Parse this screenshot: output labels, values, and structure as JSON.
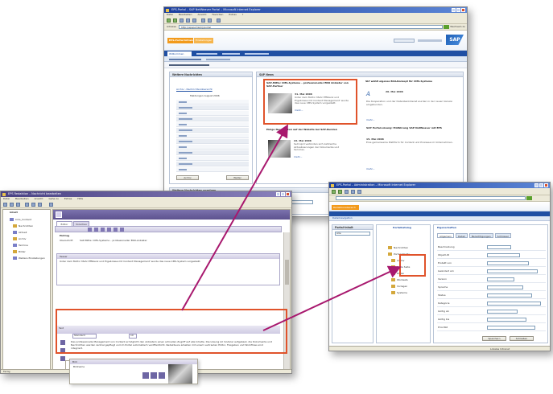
{
  "browser_window": {
    "title": "EPS-Portal – SAP NetWeaver Portal – Microsoft Internet Explorer",
    "menu": [
      "Datei",
      "Bearbeiten",
      "Ansicht",
      "Favoriten",
      "Extras",
      "?"
    ],
    "address_label": "Adresse",
    "address": "http://epsportal/irj/portal",
    "go_label": "Wechseln zu",
    "header_tabs": [
      "EPS-Portal Intranet",
      "Einstellungen"
    ],
    "sap_logo": "SAP",
    "welcome": "Willkommen",
    "news_title": "SAP News",
    "left_portlet_title": "Weitere Nachrichten",
    "left_portlet_link": "Archiv › Nachrichtenübersicht",
    "left_portlet_subtitle": "Meldungen August 2006",
    "left_buttons": [
      "Archiv",
      "Weiter"
    ],
    "news_items": [
      {
        "headline": "SAP-Mitte: CMS-Systeme – professioneller ERD Anbieter von SAP-Partner",
        "date": "31. Mai 2006",
        "body": "Unter dem Motto 'Mehr Effizienz und Ergebnisse mit Content Management' wurde das neue CMS-System vorgestellt.",
        "more": "mehr..."
      },
      {
        "headline": "Einige Neuigkeiten auf der Website bei SAP-Kunden",
        "date": "22. Mai 2006",
        "body": "Seit April verbinden sich zahlreiche Aktualisierungen der Dokumente und Services.",
        "more": "mehr..."
      },
      {
        "headline": "SLT wählt eigenes Bild-Konzept für CMS-Systeme",
        "date": "20. Mai 2006",
        "body": "Die Kooperation und der Datenbankdienst wurden in der neuen Version eingebunden.",
        "more": "mehr..."
      },
      {
        "headline": "SAP Portal-Lösung: Einführung SAP NetWeaver mit EPS",
        "date": "15. Mai 2006",
        "body": "Eine gemeinsame Plattform für Content und Prozesse im Unternehmen.",
        "more": "mehr..."
      }
    ],
    "bottom_section_title": "Weitere Nachrichten anzeigen",
    "bottom_labels": [
      "Inhalt",
      "Kategorie",
      "Sortierung"
    ]
  },
  "editor_window": {
    "title": "EPS Redaktion – Nachricht bearbeiten",
    "menu": [
      "Datei",
      "Bearbeiten",
      "Ansicht",
      "Gehe zu",
      "Extras",
      "Hilfe"
    ],
    "tree_root": "Inhalt",
    "tree_items": [
      "Cms_Content",
      "Nachrichten",
      "Aktuell",
      "Archiv",
      "Termine",
      "Bilder",
      "Weitere Einstellungen"
    ],
    "tabs": [
      "Editor",
      "Vorschau"
    ],
    "section_1": "Eintrag",
    "title_label": "Überschrift",
    "title_value": "SAP-Mitte: CMS-Systeme – professioneller ERD-Anbieter",
    "teaser_label": "Teaser",
    "teaser_value": "Unter dem Motto 'Mehr Effizienz und Ergebnisse mit Content Management' wurde das neue CMS-System vorgestellt.",
    "text_label": "Text",
    "format_select": "Standard",
    "format_size": "10",
    "body_text": "Das professionelle Management von Content ermöglicht den Anbietern einen schnellen Zugriff auf alle Inhalte. Die Lösung ist modular aufgebaut, die Dokumente und Nachrichten werden zentral gepflegt und im Portal automatisch veröffentlicht. Redakteure arbeiten mit einem vertrauten Editor, Freigaben und Workflows sind integriert.",
    "image_label": "Bild",
    "image_value": "Bildname",
    "status": "Fertig"
  },
  "admin_window": {
    "title": "EPS-Portal – Administration – Microsoft Internet Explorer",
    "header_tab": "Redaktionsbereich",
    "crumb": "Detailnavigation",
    "left_title": "Portal-Inhalt",
    "left_select": "Alle",
    "tree_title": "Portalkatalog",
    "tree_items": [
      "Nachrichten",
      "Portal Inhalte",
      "Archiv",
      "Neue Seite",
      "Rollen",
      "Worksets",
      "Vorlagen",
      "Systeme"
    ],
    "form_title": "Eigenschaften",
    "form_tabs": [
      "Allgemein",
      "Detail",
      "Berechtigungen",
      "Schlüssel"
    ],
    "form_fields": [
      "Beschreibung",
      "Objekt-ID",
      "Erstellt von",
      "Geändert am",
      "Version",
      "Sprache",
      "Status",
      "Kategorie",
      "Gültig ab",
      "Gültig bis",
      "Priorität"
    ],
    "buttons": [
      "Speichern",
      "Schließen"
    ],
    "status": "Lokales Intranet"
  },
  "colors": {
    "highlight": "#e0532b",
    "arrow": "#a8186e",
    "sap_orange": "#f29a1b",
    "sap_blue": "#1f4fa3",
    "editor_purple": "#5d528f"
  },
  "icons": [
    "window-icon",
    "minimize-icon",
    "maximize-icon",
    "close-icon",
    "folder-icon",
    "news-thumbnail",
    "bold-icon",
    "italic-icon",
    "sap-logo"
  ]
}
